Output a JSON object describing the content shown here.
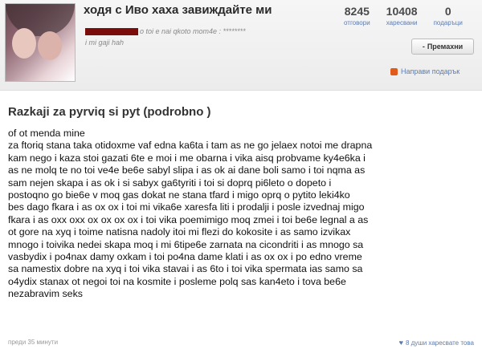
{
  "profile": {
    "username": "ходя с Иво хаха завиждайте ми",
    "status_line1": "o toi e nai qkoto mom4e : ********",
    "status_line2": "i mi gaji hah"
  },
  "stats": [
    {
      "value": "8245",
      "label": "отговори"
    },
    {
      "value": "10408",
      "label": "харесвани"
    },
    {
      "value": "0",
      "label": "подаръци"
    }
  ],
  "actions": {
    "remove_label": "Премахни",
    "gift_label": "Направи подарък"
  },
  "post": {
    "title": "Razkaji za pyrviq si pyt (podrobno )",
    "body": "of ot menda mine\nza ftoriq stana taka otidoxme vaf edna ka6ta i tam as ne go jelaex notoi me drapna\nkam nego i kaza stoi gazati 6te e moi i me obarna i vika aisq probvame ky4e6ka i\nas ne molq te no toi ve4e be6e sabyl slipa i as ok ai dane boli samo i toi nqma as\nsam nejen skapa i as ok i si sabyx ga6tyriti i toi si doprq pi6leto o dopeto i\npostoqno go bie6e v moq gas dokat ne stana tfard i migo oprq o pytito leki4ko\nbes dago fkara i as ox ox i toi mi vika6e xaresfa liti i prodalji i posle izvednaj migo\nfkara i as oxx oxx ox ox ox ox i toi vika poemimigo moq zmei i toi be6e legnal a as\not gore na xyq i toime natisna nadoly itoi mi flezi do kokosite i as samo izvikax\nmnogo i toivika nedei skapa moq i mi 6tipe6e zarnata na cicondriti i as mnogo sa\nvasbydix i po4nax damy oxkam i toi po4na dame klati i as ox ox i po edno vreme\nsa namestix dobre na xyq i toi vika stavai i as 6to i toi vika spermata ias samo sa\no4ydix stanax ot negoi toi na kosmite i posleme polq sas kan4eto i tova be6e\nnezabravim seks",
    "time": "преди 35 минути",
    "likes": "8 души харесвате това"
  }
}
